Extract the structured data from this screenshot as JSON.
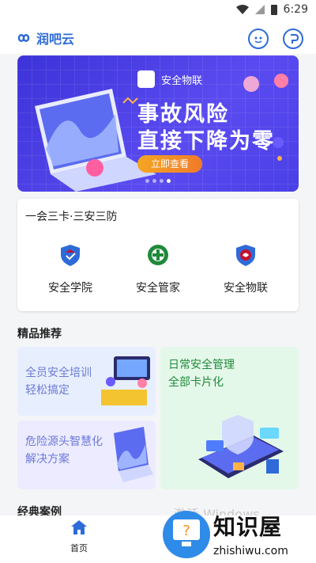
{
  "status": {
    "time": "6:29"
  },
  "header": {
    "app_name": "润吧云"
  },
  "banner": {
    "chip_label": "安全物联",
    "headline_line1": "事故风险",
    "headline_line2": "直接下降为零",
    "cta_label": "立即查看",
    "page_count": 4,
    "active_page": 4
  },
  "services_card": {
    "title": "一会三卡·三安三防",
    "items": [
      {
        "label": "安全学院",
        "icon": "shield-graduation-icon",
        "color": "#2f6bd8"
      },
      {
        "label": "安全管家",
        "icon": "safety-emblem-icon",
        "color": "#1f8a3a"
      },
      {
        "label": "安全物联",
        "icon": "shield-iot-icon",
        "color": "#2f6bd8"
      }
    ]
  },
  "recommend": {
    "title": "精品推荐",
    "tiles": [
      {
        "line1": "全员安全培训",
        "line2": "轻松搞定",
        "color": "#6c7ad8"
      },
      {
        "line1": "日常安全管理",
        "line2": "全部卡片化",
        "color": "#1f8a3a"
      },
      {
        "line1": "危险源头智慧化",
        "line2": "解决方案",
        "color": "#6c7ad8"
      }
    ]
  },
  "cases": {
    "title": "经典案例"
  },
  "tabbar": {
    "home_label": "首页"
  },
  "overlay": {
    "windows_activate": "激活 Windows",
    "brand": "知识屋",
    "brand_url": "zhishiwu.com"
  },
  "colors": {
    "accent": "#2f6bd8",
    "banner_bg": "#4a3fe6",
    "cta": "#f5a623"
  }
}
